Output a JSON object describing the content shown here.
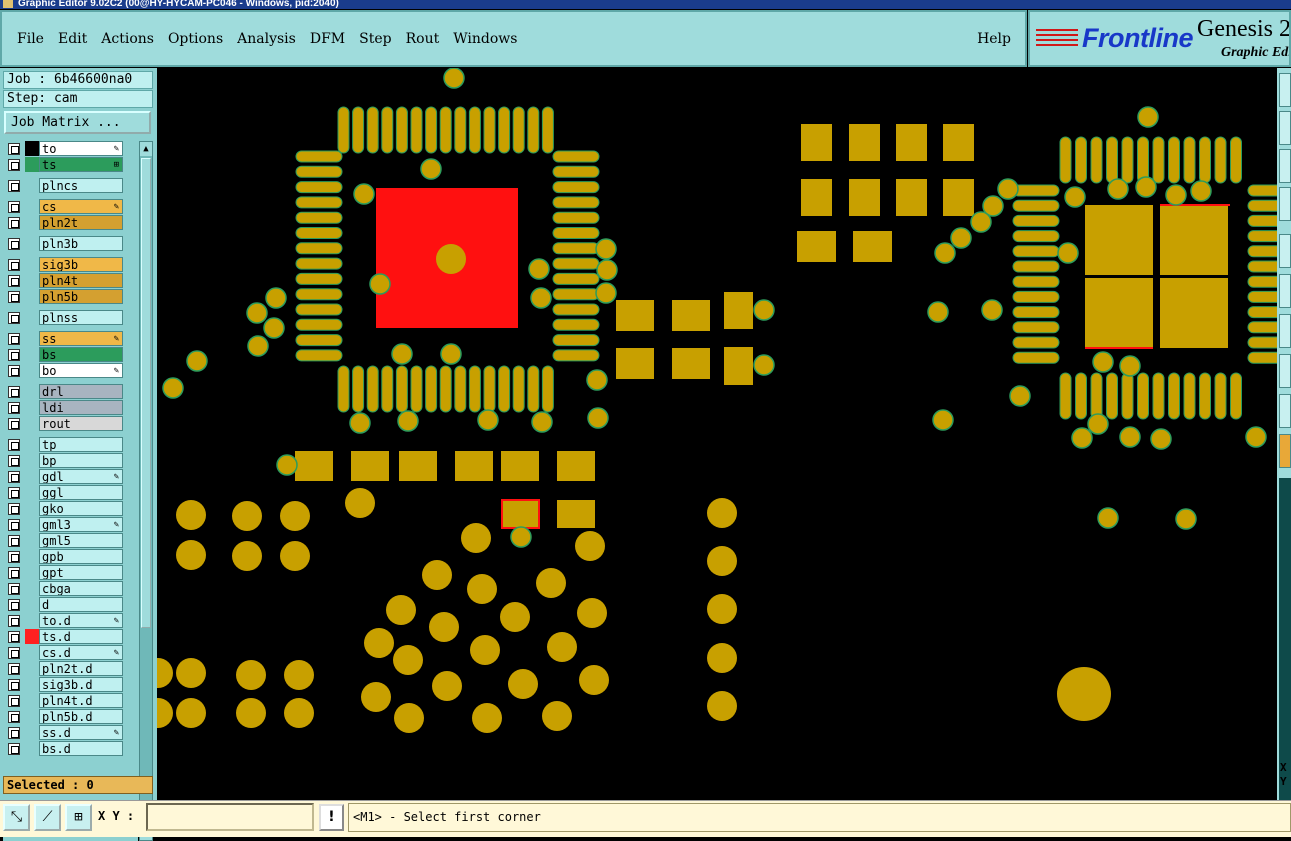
{
  "window": {
    "title": "Graphic Editor 9.02C2 (00@HY-HYCAM-PC046 - Windows, pid:2040)"
  },
  "menu": {
    "items": [
      {
        "label": "File",
        "id": "file"
      },
      {
        "label": "Edit",
        "id": "edit"
      },
      {
        "label": "Actions",
        "id": "actions"
      },
      {
        "label": "Options",
        "id": "options"
      },
      {
        "label": "Analysis",
        "id": "analysis"
      },
      {
        "label": "DFM",
        "id": "dfm"
      },
      {
        "label": "Step",
        "id": "step"
      },
      {
        "label": "Rout",
        "id": "rout"
      },
      {
        "label": "Windows",
        "id": "windows"
      }
    ],
    "help": "Help"
  },
  "brand": {
    "logo": "Frontline",
    "product": "Genesis 2",
    "subtitle": "Graphic Edit"
  },
  "job": {
    "label": "Job : 6b46600na0",
    "step": "Step: cam",
    "matrix_button": "Job Matrix ..."
  },
  "layers": [
    {
      "name": "to",
      "color": "#ffffff",
      "swatch": "#000000",
      "edit": "✎"
    },
    {
      "name": "ts",
      "color": "#2c9c5c",
      "swatch": "#2c9c5c",
      "edit": "⊞",
      "active": true
    },
    {
      "name": "plncs",
      "color": "#bff0f0",
      "swatch": "",
      "edit": ""
    },
    {
      "name": "cs",
      "color": "#f0b848",
      "swatch": "",
      "edit": "✎"
    },
    {
      "name": "pln2t",
      "color": "#d4a030",
      "swatch": "",
      "edit": ""
    },
    {
      "name": "pln3b",
      "color": "#bff0f0",
      "swatch": "",
      "edit": ""
    },
    {
      "name": "sig3b",
      "color": "#f0b848",
      "swatch": "",
      "edit": ""
    },
    {
      "name": "pln4t",
      "color": "#d4a030",
      "swatch": "",
      "edit": ""
    },
    {
      "name": "pln5b",
      "color": "#d4a030",
      "swatch": "",
      "edit": ""
    },
    {
      "name": "plnss",
      "color": "#bff0f0",
      "swatch": "",
      "edit": ""
    },
    {
      "name": "ss",
      "color": "#f0b848",
      "swatch": "",
      "edit": "✎"
    },
    {
      "name": "bs",
      "color": "#2c9c5c",
      "swatch": "",
      "edit": ""
    },
    {
      "name": "bo",
      "color": "#ffffff",
      "swatch": "",
      "edit": "✎"
    },
    {
      "name": "drl",
      "color": "#a8b4c0",
      "swatch": "",
      "edit": ""
    },
    {
      "name": "ldi",
      "color": "#a8b4c0",
      "swatch": "",
      "edit": ""
    },
    {
      "name": "rout",
      "color": "#d8d8d8",
      "swatch": "",
      "edit": ""
    },
    {
      "name": "tp",
      "color": "#bff0f0",
      "swatch": "",
      "edit": ""
    },
    {
      "name": "bp",
      "color": "#bff0f0",
      "swatch": "",
      "edit": ""
    },
    {
      "name": "gdl",
      "color": "#bff0f0",
      "swatch": "",
      "edit": "✎"
    },
    {
      "name": "ggl",
      "color": "#bff0f0",
      "swatch": "",
      "edit": ""
    },
    {
      "name": "gko",
      "color": "#bff0f0",
      "swatch": "",
      "edit": ""
    },
    {
      "name": "gml3",
      "color": "#bff0f0",
      "swatch": "",
      "edit": "✎"
    },
    {
      "name": "gml5",
      "color": "#bff0f0",
      "swatch": "",
      "edit": ""
    },
    {
      "name": "gpb",
      "color": "#bff0f0",
      "swatch": "",
      "edit": ""
    },
    {
      "name": "gpt",
      "color": "#bff0f0",
      "swatch": "",
      "edit": ""
    },
    {
      "name": "cbga",
      "color": "#bff0f0",
      "swatch": "",
      "edit": ""
    },
    {
      "name": "d",
      "color": "#bff0f0",
      "swatch": "",
      "edit": ""
    },
    {
      "name": "to.d",
      "color": "#bff0f0",
      "swatch": "",
      "edit": "✎"
    },
    {
      "name": "ts.d",
      "color": "#bff0f0",
      "swatch": "#ff2020",
      "edit": ""
    },
    {
      "name": "cs.d",
      "color": "#bff0f0",
      "swatch": "",
      "edit": "✎"
    },
    {
      "name": "pln2t.d",
      "color": "#bff0f0",
      "swatch": "",
      "edit": ""
    },
    {
      "name": "sig3b.d",
      "color": "#bff0f0",
      "swatch": "",
      "edit": ""
    },
    {
      "name": "pln4t.d",
      "color": "#bff0f0",
      "swatch": "",
      "edit": ""
    },
    {
      "name": "pln5b.d",
      "color": "#bff0f0",
      "swatch": "",
      "edit": ""
    },
    {
      "name": "ss.d",
      "color": "#bff0f0",
      "swatch": "",
      "edit": "✎"
    },
    {
      "name": "bs.d",
      "color": "#bff0f0",
      "swatch": "",
      "edit": ""
    }
  ],
  "selected": "Selected : 0",
  "status": {
    "xy_label": "X Y :",
    "xy_value": "",
    "prompt": "<M1> - Select first corner",
    "prompt_icon": "!"
  },
  "right": {
    "x_label": "X",
    "y_label": "Y"
  },
  "colors": {
    "pad": "#c8a000",
    "pad_outline": "#2c9c5c",
    "highlight": "#ff1010",
    "canvas": "#000000"
  },
  "icons": [
    "zoom-icon",
    "measure-icon",
    "grid-icon",
    "warning-icon"
  ]
}
